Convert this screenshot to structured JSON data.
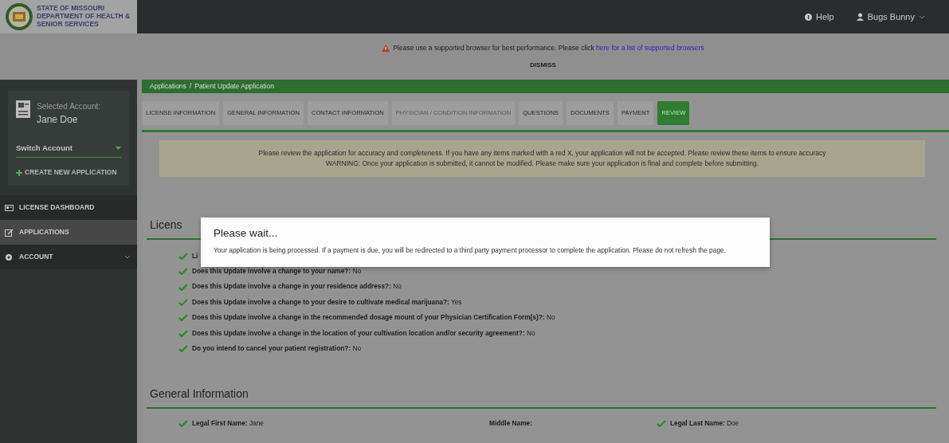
{
  "header": {
    "logo_lines": [
      "STATE OF MISSOURI",
      "DEPARTMENT OF HEALTH &",
      "SENIOR SERVICES"
    ],
    "help": "Help",
    "user": "Bugs Bunny"
  },
  "alert": {
    "text": "Please use a supported browser for best performance. Please click ",
    "link": "here for a list of supported browsers",
    "dismiss": "DISMISS"
  },
  "sidebar": {
    "account_label": "Selected Account:",
    "account_name": "Jane Doe",
    "switch": "Switch Account",
    "create": "CREATE NEW APPLICATION",
    "items": [
      {
        "label": "LICENSE DASHBOARD",
        "kind": "dashboard",
        "selected": false,
        "expandable": false
      },
      {
        "label": "APPLICATIONS",
        "kind": "edit",
        "selected": true,
        "expandable": false
      },
      {
        "label": "ACCOUNT",
        "kind": "gear",
        "selected": false,
        "expandable": true
      }
    ]
  },
  "breadcrumb": {
    "items": [
      "Applications",
      "Patient Update Application"
    ],
    "separator": "/"
  },
  "tabs": [
    {
      "label": "LICENSE INFORMATION",
      "selected": false,
      "disabled": false
    },
    {
      "label": "GENERAL INFORMATION",
      "selected": false,
      "disabled": false
    },
    {
      "label": "CONTACT INFORMATION",
      "selected": false,
      "disabled": false
    },
    {
      "label": "PHYSICIAN / CONDITION INFORMATION",
      "selected": false,
      "disabled": true
    },
    {
      "label": "QUESTIONS",
      "selected": false,
      "disabled": false
    },
    {
      "label": "DOCUMENTS",
      "selected": false,
      "disabled": false
    },
    {
      "label": "PAYMENT",
      "selected": false,
      "disabled": false
    },
    {
      "label": "REVIEW",
      "selected": true,
      "disabled": false
    }
  ],
  "notice": [
    "Please review the application for accuracy and completeness. If you have any items marked with a red X, your application will not be accepted. Please review these items to ensure accuracy",
    "WARNING: Once your application is submitted, it cannot be modified. Please make sure your application is final and complete before submitting."
  ],
  "sections": [
    {
      "title": "Licens",
      "kind": "list",
      "items": [
        {
          "label": "Li",
          "checked": true
        },
        {
          "label": "Does this Update involve a change to your name?:",
          "value": "No",
          "checked": true
        },
        {
          "label": "Does this Update involve a change in your residence address?:",
          "value": "No",
          "checked": true
        },
        {
          "label": "Does this Update involve a change to your desire to cultivate medical marijuana?:",
          "value": "Yes",
          "checked": true
        },
        {
          "label": "Does this Update involve a change in the recommended dosage mount of your Physician Certification Form(s)?:",
          "value": "No",
          "checked": true
        },
        {
          "label": "Does this Update involve a change in the location of your cultivation location and/or security agreement?:",
          "value": "No",
          "checked": true
        },
        {
          "label": "Do you intend to cancel your patient registration?:",
          "value": "No",
          "checked": true
        }
      ]
    },
    {
      "title": "General Information",
      "kind": "columns",
      "items": [
        {
          "label": "Legal First Name:",
          "value": "Jane",
          "checked": true
        },
        {
          "label": "Middle Name:",
          "checked": false
        },
        {
          "label": "Legal Last Name:",
          "value": "Doe",
          "checked": true
        }
      ]
    }
  ],
  "modal": {
    "title": "Please wait...",
    "body": "Your application is being processed. If a payment is due, you will be redirected to a third party payment processor to complete the application. Please do not refresh the page."
  }
}
